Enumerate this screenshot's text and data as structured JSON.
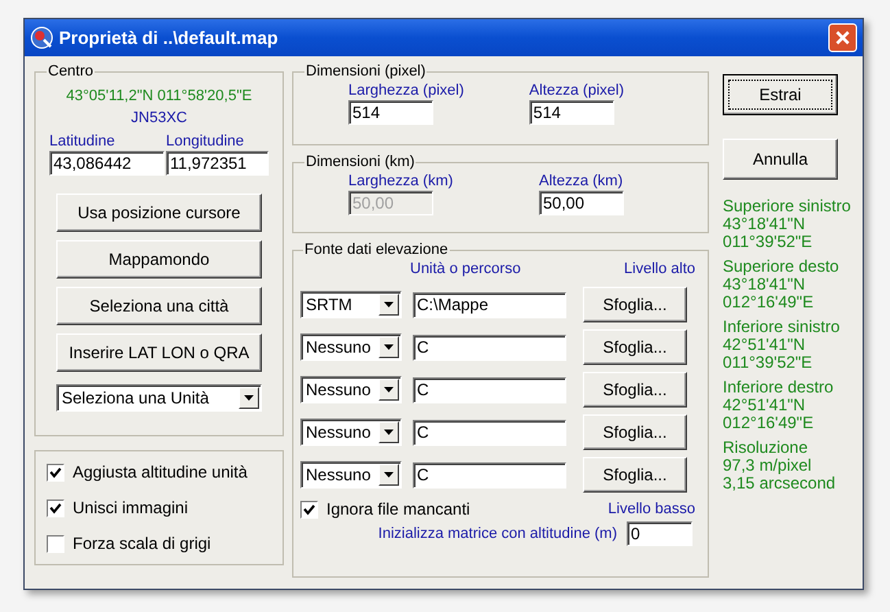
{
  "window": {
    "title": "Proprietà di ..\\default.map"
  },
  "centro": {
    "title": "Centro",
    "coords": "43°05'11,2\"N 011°58'20,5\"E",
    "qra": "JN53XC",
    "lat": {
      "label": "Latitudine",
      "value": "43,086442"
    },
    "lon": {
      "label": "Longitudine",
      "value": "11,972351"
    },
    "buttons": [
      "Usa posizione cursore",
      "Mappamondo",
      "Seleziona una città",
      "Inserire LAT LON o QRA"
    ],
    "unit_select": "Seleziona una Unità"
  },
  "options": [
    {
      "label": "Aggiusta altitudine unità",
      "checked": true
    },
    {
      "label": "Unisci immagini",
      "checked": true
    },
    {
      "label": "Forza scala di grigi",
      "checked": false
    }
  ],
  "pixel_dims": {
    "title": "Dimensioni (pixel)",
    "fields": [
      {
        "label": "Larghezza (pixel)",
        "value": "514",
        "disabled": false
      },
      {
        "label": "Altezza (pixel)",
        "value": "514",
        "disabled": false
      }
    ]
  },
  "km_dims": {
    "title": "Dimensioni (km)",
    "fields": [
      {
        "label": "Larghezza (km)",
        "value": "50,00",
        "disabled": true
      },
      {
        "label": "Altezza (km)",
        "value": "50,00",
        "disabled": false
      }
    ]
  },
  "elevation": {
    "title": "Fonte dati elevazione",
    "path_header": "Unità o percorso",
    "high_level_label": "Livello alto",
    "rows": [
      {
        "source": "SRTM",
        "path": "C:\\Mappe",
        "button": "Sfoglia..."
      },
      {
        "source": "Nessuno",
        "path": "C",
        "button": "Sfoglia..."
      },
      {
        "source": "Nessuno",
        "path": "C",
        "button": "Sfoglia..."
      },
      {
        "source": "Nessuno",
        "path": "C",
        "button": "Sfoglia..."
      },
      {
        "source": "Nessuno",
        "path": "C",
        "button": "Sfoglia..."
      }
    ],
    "ignore_missing": {
      "label": "Ignora file mancanti",
      "checked": true
    },
    "low_level_label": "Livello basso",
    "init_label": "Inizializza matrice con altitudine (m)",
    "init_value": "0"
  },
  "actions": [
    {
      "label": "Estrai",
      "default": true
    },
    {
      "label": "Annulla",
      "default": false
    }
  ],
  "info": [
    {
      "title": "Superiore sinistro",
      "lines": [
        "43°18'41\"N",
        "011°39'52\"E"
      ]
    },
    {
      "title": "Superiore desto",
      "lines": [
        "43°18'41\"N",
        "012°16'49\"E"
      ]
    },
    {
      "title": "Inferiore sinistro",
      "lines": [
        "42°51'41\"N",
        "011°39'52\"E"
      ]
    },
    {
      "title": "Inferiore destro",
      "lines": [
        "42°51'41\"N",
        "012°16'49\"E"
      ]
    },
    {
      "title": "Risoluzione",
      "lines": [
        "97,3 m/pixel",
        "3,15 arcsecond"
      ]
    }
  ]
}
